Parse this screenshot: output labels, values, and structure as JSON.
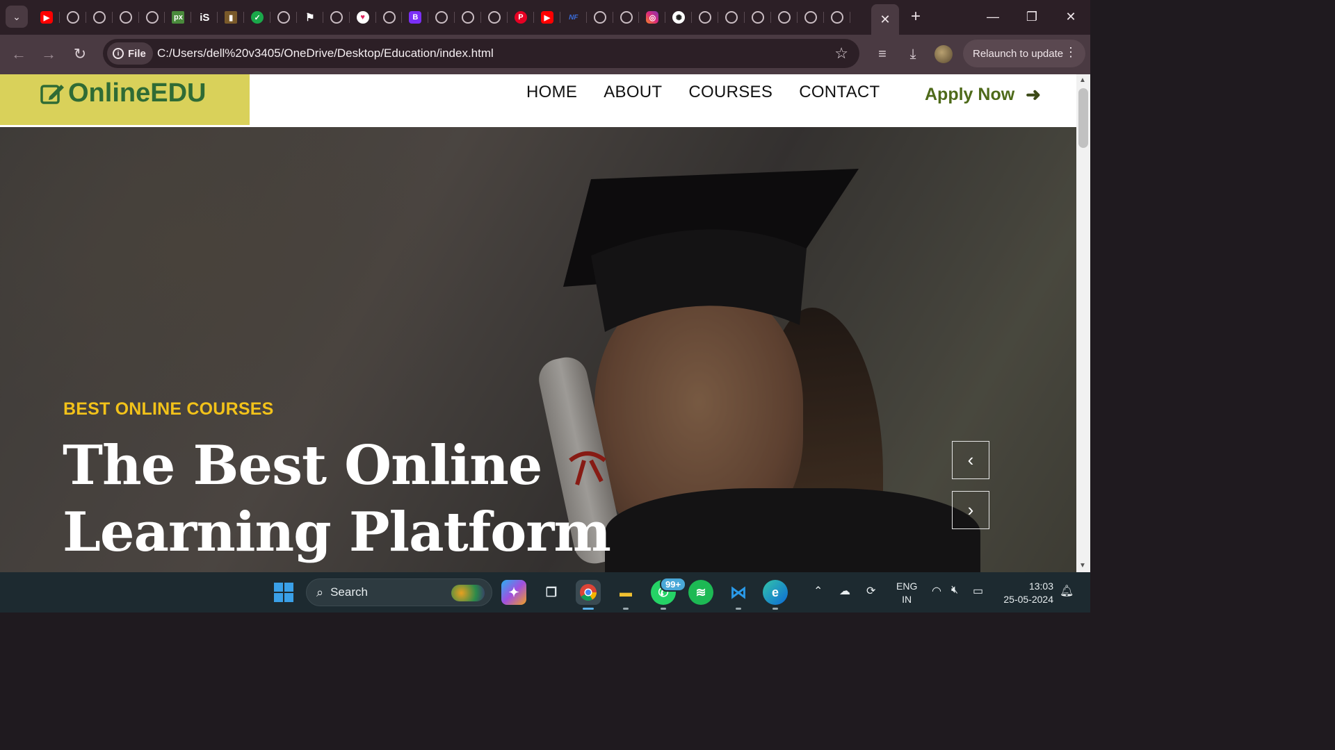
{
  "browser": {
    "tab_favicons": [
      "youtube-icon",
      "globe-icon",
      "globe-icon",
      "globe-icon",
      "globe-icon",
      "pixabay-icon",
      "istock-icon",
      "book-icon",
      "check-icon",
      "globe-icon",
      "flag-icon",
      "globe-icon",
      "heart-icon",
      "globe-icon",
      "bootstrap-icon",
      "globe-icon",
      "globe-icon",
      "globe-icon",
      "pinterest-icon",
      "youtube-icon",
      "nf-icon",
      "globe-icon",
      "globe-icon",
      "instagram-icon",
      "openai-icon",
      "globe-icon",
      "globe-icon",
      "globe-icon",
      "globe-icon",
      "globe-icon",
      "globe-icon"
    ],
    "tab_glyphs": {
      "px": "px",
      "is": "iS",
      "book": "▮",
      "check": "✓",
      "flag": "⚑",
      "heart": "♥",
      "boot": "B",
      "pin": "P",
      "nf": "NF",
      "gpt": "✺",
      "yt": "▶",
      "ig": "◎"
    },
    "close_tab_glyph": "✕",
    "new_tab_glyph": "+",
    "site_chip": "File",
    "url": "C:/Users/dell%20v3405/OneDrive/Desktop/Education/index.html",
    "relaunch_label": "Relaunch to update"
  },
  "site": {
    "logo_text": "OnlineEDU",
    "nav": [
      "HOME",
      "ABOUT",
      "COURSES",
      "CONTACT"
    ],
    "apply_label": "Apply Now",
    "hero": {
      "subtitle": "BEST ONLINE COURSES",
      "title_line1": "The Best Online",
      "title_line2": "Learning Platform"
    }
  },
  "taskbar": {
    "search_label": "Search",
    "whatsapp_badge": "99+",
    "lang_line1": "ENG",
    "lang_line2": "IN",
    "time": "13:03",
    "date": "25-05-2024"
  },
  "colors": {
    "logo_bg": "#d9d15a",
    "logo_text": "#2f6b35",
    "hero_subtitle": "#f2c21a",
    "apply_text": "#4e6a1a"
  }
}
